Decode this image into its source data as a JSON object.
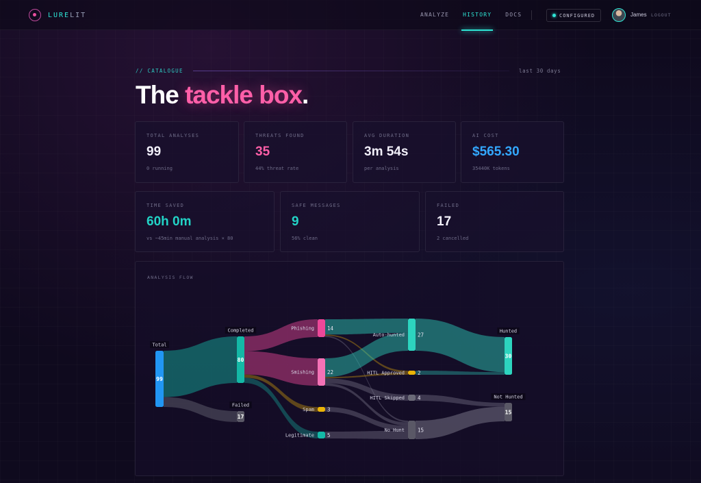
{
  "brand": {
    "part1": "LURE",
    "part2": "LIT"
  },
  "nav": {
    "items": [
      {
        "label": "ANALYZE",
        "active": false
      },
      {
        "label": "HISTORY",
        "active": true
      },
      {
        "label": "DOCS",
        "active": false
      }
    ],
    "status_badge": "CONFIGURED",
    "user_name": "James",
    "logout_label": "LOGOUT"
  },
  "section": {
    "tag": "// CATALOGUE",
    "range": "last 30 days",
    "title_prefix": "The ",
    "title_accent": "tackle box",
    "title_suffix": "."
  },
  "stats_row1": [
    {
      "label": "TOTAL ANALYSES",
      "value": "99",
      "sub": "0 running",
      "color": "#f2f0fa"
    },
    {
      "label": "THREATS FOUND",
      "value": "35",
      "sub": "44% threat rate",
      "color": "#ff5fa8"
    },
    {
      "label": "AVG DURATION",
      "value": "3m 54s",
      "sub": "per analysis",
      "color": "#f2f0fa"
    },
    {
      "label": "AI COST",
      "value": "$565.30",
      "sub": "35440K tokens",
      "color": "#33a8ff"
    }
  ],
  "stats_row2": [
    {
      "label": "TIME SAVED",
      "value": "60h 0m",
      "sub": "vs ~45min manual analysis × 80",
      "color": "#22d3c6"
    },
    {
      "label": "SAFE MESSAGES",
      "value": "9",
      "sub": "56% clean",
      "color": "#22d3c6"
    },
    {
      "label": "FAILED",
      "value": "17",
      "sub": "2 cancelled",
      "color": "#f2f0fa"
    }
  ],
  "flow": {
    "label": "ANALYSIS FLOW",
    "nodes": [
      {
        "id": "total",
        "label": "Total",
        "count": "99",
        "color": "#2196f3"
      },
      {
        "id": "completed",
        "label": "Completed",
        "count": "80",
        "color": "#14b8a6"
      },
      {
        "id": "failed",
        "label": "Failed",
        "count": "17",
        "color": "#5a5866"
      },
      {
        "id": "phishing",
        "label": "Phishing",
        "count": "14",
        "color": "#ec4899"
      },
      {
        "id": "smishing",
        "label": "Smishing",
        "count": "22",
        "color": "#f472b6"
      },
      {
        "id": "spam",
        "label": "Spam",
        "count": "3",
        "color": "#eab308"
      },
      {
        "id": "legitimate",
        "label": "Legitimate",
        "count": "5",
        "color": "#14b8a6"
      },
      {
        "id": "autohunted",
        "label": "Auto-hunted",
        "count": "27",
        "color": "#2dd4bf"
      },
      {
        "id": "hitlapproved",
        "label": "HITL Approved",
        "count": "2",
        "color": "#eab308"
      },
      {
        "id": "hitlskipped",
        "label": "HITL Skipped",
        "count": "4",
        "color": "#6b6a78"
      },
      {
        "id": "nohunt",
        "label": "No Hunt",
        "count": "15",
        "color": "#5a5866"
      },
      {
        "id": "hunted",
        "label": "Hunted",
        "count": "30",
        "color": "#2dd4bf"
      },
      {
        "id": "nothunted",
        "label": "Not Hunted",
        "count": "15",
        "color": "#5a5866"
      }
    ],
    "links": [
      {
        "from": "total",
        "to": "completed",
        "value": 80,
        "color": "#14b8a6"
      },
      {
        "from": "total",
        "to": "failed",
        "value": 17,
        "color": "#6b6a78"
      },
      {
        "from": "completed",
        "to": "phishing",
        "value": 14,
        "color": "#ec4899"
      },
      {
        "from": "completed",
        "to": "smishing",
        "value": 22,
        "color": "#ec4899"
      },
      {
        "from": "completed",
        "to": "spam",
        "value": 3,
        "color": "#eab308"
      },
      {
        "from": "completed",
        "to": "legitimate",
        "value": 5,
        "color": "#14b8a6"
      },
      {
        "from": "phishing",
        "to": "autohunted",
        "value": 12,
        "color": "#2dd4bf"
      },
      {
        "from": "phishing",
        "to": "hitlapproved",
        "value": 1,
        "color": "#eab308"
      },
      {
        "from": "phishing",
        "to": "nohunt",
        "value": 1,
        "color": "#8a889a"
      },
      {
        "from": "smishing",
        "to": "autohunted",
        "value": 15,
        "color": "#2dd4bf"
      },
      {
        "from": "smishing",
        "to": "hitlapproved",
        "value": 1,
        "color": "#eab308"
      },
      {
        "from": "smishing",
        "to": "hitlskipped",
        "value": 4,
        "color": "#8a889a"
      },
      {
        "from": "smishing",
        "to": "nohunt",
        "value": 2,
        "color": "#8a889a"
      },
      {
        "from": "spam",
        "to": "nohunt",
        "value": 3,
        "color": "#8a889a"
      },
      {
        "from": "legitimate",
        "to": "nohunt",
        "value": 5,
        "color": "#8a889a"
      },
      {
        "from": "autohunted",
        "to": "hunted",
        "value": 27,
        "color": "#2dd4bf"
      },
      {
        "from": "hitlapproved",
        "to": "hunted",
        "value": 2,
        "color": "#2dd4bf"
      },
      {
        "from": "hitlskipped",
        "to": "nothunted",
        "value": 4,
        "color": "#8a889a"
      },
      {
        "from": "nohunt",
        "to": "nothunted",
        "value": 15,
        "color": "#8a889a"
      }
    ]
  }
}
